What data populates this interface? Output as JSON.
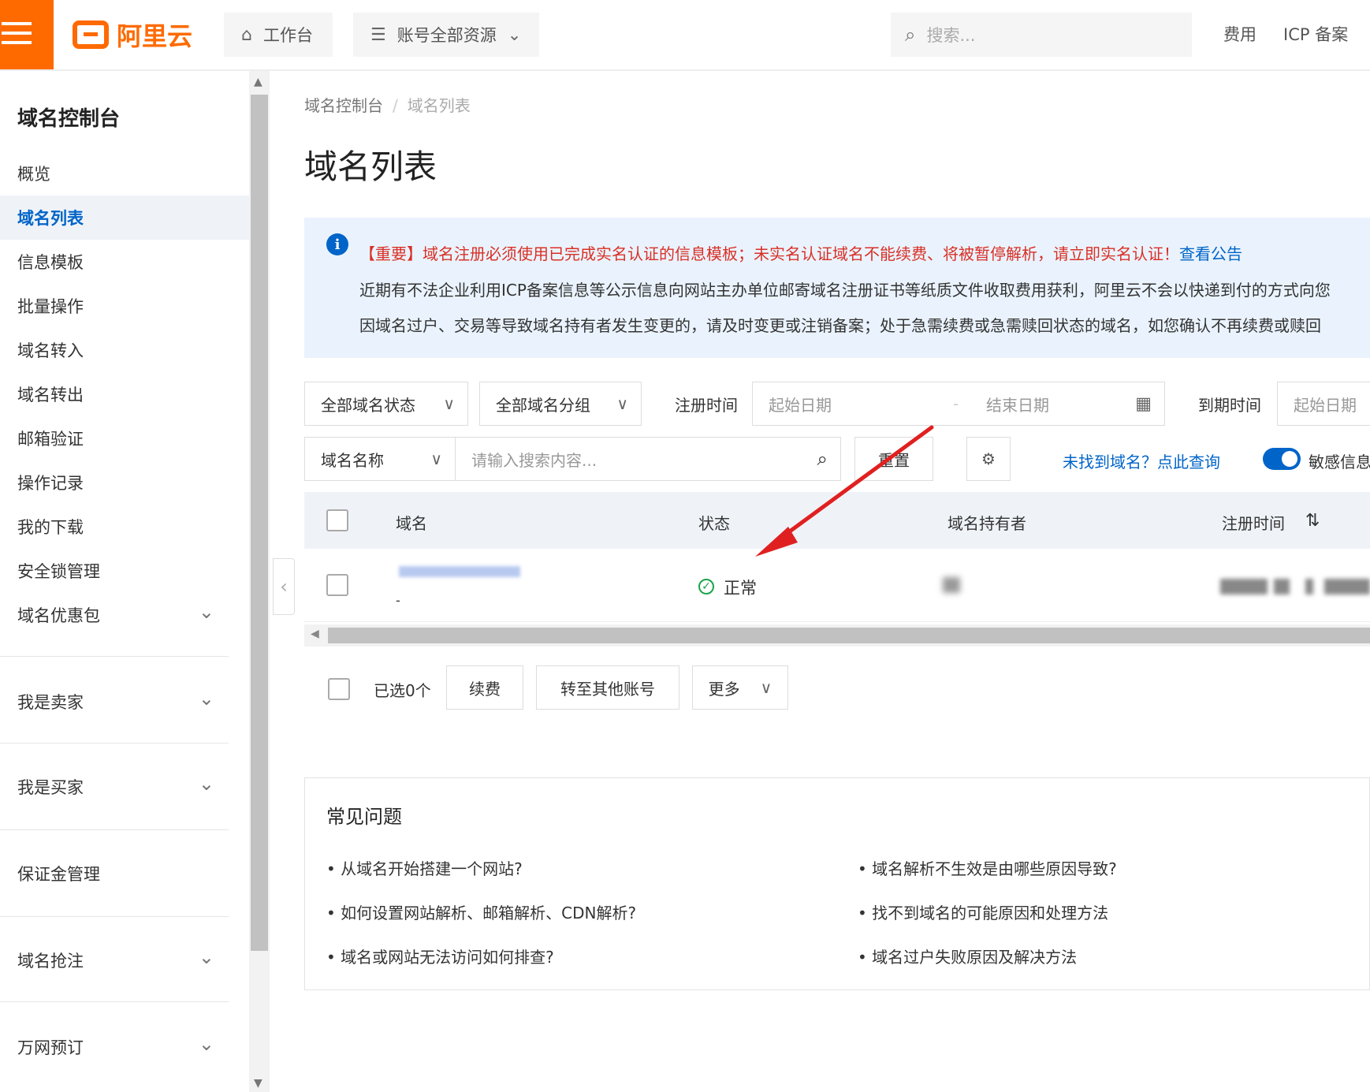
{
  "topbar": {
    "logo_text": "阿里云",
    "workbench": "工作台",
    "resources": "账号全部资源",
    "search_placeholder": "搜索...",
    "links": [
      "费用",
      "ICP 备案"
    ]
  },
  "sidebar": {
    "title": "域名控制台",
    "items": [
      {
        "label": "概览"
      },
      {
        "label": "域名列表",
        "active": true
      },
      {
        "label": "信息模板"
      },
      {
        "label": "批量操作"
      },
      {
        "label": "域名转入"
      },
      {
        "label": "域名转出"
      },
      {
        "label": "邮箱验证"
      },
      {
        "label": "操作记录"
      },
      {
        "label": "我的下载"
      },
      {
        "label": "安全锁管理"
      },
      {
        "label": "域名优惠包",
        "expandable": true
      },
      {
        "label": "我是卖家",
        "expandable": true
      },
      {
        "label": "我是买家",
        "expandable": true
      },
      {
        "label": "保证金管理"
      },
      {
        "label": "域名抢注",
        "expandable": true
      },
      {
        "label": "万网预订",
        "expandable": true
      }
    ]
  },
  "breadcrumb": [
    "域名控制台",
    "域名列表"
  ],
  "page_title": "域名列表",
  "notice": {
    "line1": "【重要】域名注册必须使用已完成实名认证的信息模板；未实名认证域名不能续费、将被暂停解析，请立即实名认证！",
    "line1_link": "查看公告",
    "line2": "近期有不法企业利用ICP备案信息等公示信息向网站主办单位邮寄域名注册证书等纸质文件收取费用获利，阿里云不会以快递到付的方式向您",
    "line3": "因域名过户、交易等导致域名持有者发生变更的，请及时变更或注销备案；处于急需续费或急需赎回状态的域名，如您确认不再续费或赎回"
  },
  "filters": {
    "status": "全部域名状态",
    "group": "全部域名分组",
    "reg_time_label": "注册时间",
    "start_date": "起始日期",
    "end_date": "结束日期",
    "expire_label": "到期时间",
    "expire_start": "起始日期",
    "search_field": "域名名称",
    "search_placeholder": "请输入搜索内容...",
    "reset": "重置",
    "not_found_link": "未找到域名？点此查询",
    "sensitive_label": "敏感信息"
  },
  "table": {
    "headers": [
      "域名",
      "状态",
      "域名持有者",
      "注册时间"
    ],
    "rows": [
      {
        "domain": "-",
        "status": "正常"
      }
    ]
  },
  "bulk": {
    "selected": "已选0个",
    "renew": "续费",
    "transfer": "转至其他账号",
    "more": "更多"
  },
  "faq": {
    "title": "常见问题",
    "items": [
      "从域名开始搭建一个网站?",
      "域名解析不生效是由哪些原因导致?",
      "如何设置网站解析、邮箱解析、CDN解析?",
      "找不到域名的可能原因和处理方法",
      "域名或网站无法访问如何排查?",
      "域名过户失败原因及解决方法"
    ]
  },
  "colors": {
    "brand": "#ff6a00",
    "link": "#0064c8",
    "notice_red": "#d93026",
    "status_ok": "#1aa34a",
    "annotation_arrow": "#e02020"
  }
}
